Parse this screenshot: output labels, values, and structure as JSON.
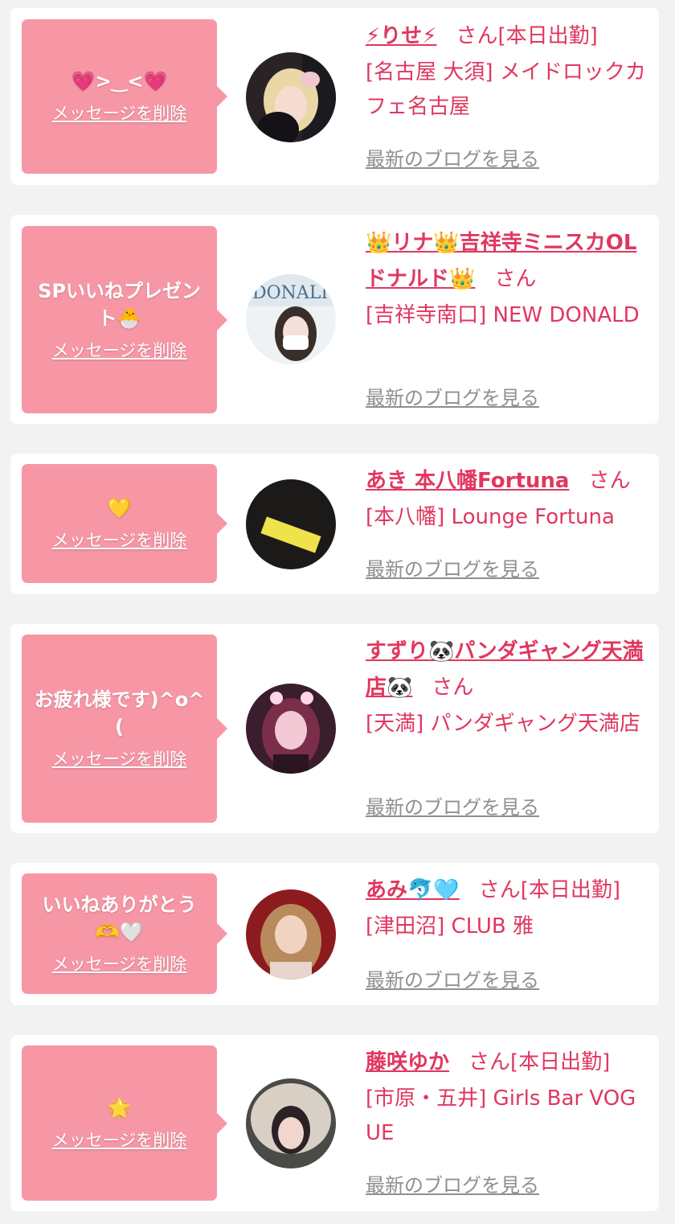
{
  "delete_label": "メッセージを削除",
  "blog_label": "最新のブログを見る",
  "san_label": "さん",
  "colors": {
    "accent_pink": "#e0375f",
    "bubble_pink": "#f797a6",
    "link_gray": "#8f8f8f",
    "background": "#f2f2f2"
  },
  "messages": [
    {
      "message": "💗>‿<💗",
      "name": "⚡りせ⚡",
      "today": "[本日出勤]",
      "shop": "[名古屋 大須] メイドロックカフェ名古屋",
      "avatar_icon": "photo-blonde-woman"
    },
    {
      "message": "SPいいねプレゼント🐣",
      "name": "👑リナ👑吉祥寺ミニスカOLドナルド👑",
      "today": "",
      "shop": "[吉祥寺南口] NEW DONALD",
      "avatar_icon": "photo-donald-sign"
    },
    {
      "message": "💛",
      "name": "あき 本八幡Fortuna",
      "today": "",
      "shop": "[本八幡] Lounge Fortuna",
      "avatar_icon": "photo-yellow-card"
    },
    {
      "message": "お疲れ様です)^o^(",
      "name": "すずり🐼パンダギャング天満店🐼",
      "today": "",
      "shop": "[天満] パンダギャング天満店",
      "avatar_icon": "photo-pink-hair-woman"
    },
    {
      "message": "いいねありがとう🫶🤍",
      "name": "あみ🐬🩵",
      "today": "[本日出勤]",
      "shop": "[津田沼] CLUB 雅",
      "avatar_icon": "photo-woman-red-bg"
    },
    {
      "message": "🌟",
      "name": "藤咲ゆか",
      "today": "[本日出勤]",
      "shop": "[市原・五井] Girls Bar VOGUE",
      "avatar_icon": "photo-fur-hood-woman"
    }
  ]
}
